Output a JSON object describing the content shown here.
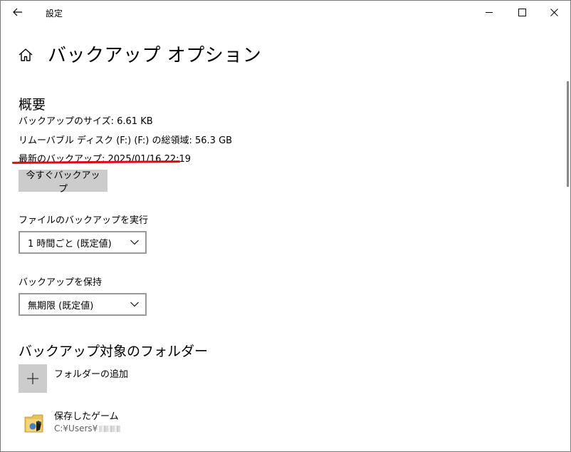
{
  "titlebar": {
    "back_icon": "back-arrow-icon",
    "app_title": "設定",
    "minimize_icon": "minimize-icon",
    "maximize_icon": "maximize-icon",
    "close_icon": "close-icon"
  },
  "header": {
    "home_icon": "home-icon",
    "title": "バックアップ オプション"
  },
  "overview": {
    "heading": "概要",
    "backup_size": "バックアップのサイズ: 6.61 KB",
    "disk_total": "リムーバブル ディスク (F:) (F:) の総領域: 56.3 GB",
    "latest_backup": "最新のバックアップ: 2025/01/16 22:19",
    "backup_now_label": "今すぐバックアップ",
    "highlight_color": "#e0061b"
  },
  "backup_frequency": {
    "label": "ファイルのバックアップを実行",
    "selected": "1 時間ごと (既定値)"
  },
  "keep_backups": {
    "label": "バックアップを保持",
    "selected": "無期限 (既定値)"
  },
  "folders": {
    "heading": "バックアップ対象のフォルダー",
    "add_label": "フォルダーの追加",
    "add_icon": "plus-icon",
    "items": [
      {
        "name": "保存したゲーム",
        "path": "C:¥Users¥",
        "icon": "saved-games-folder-icon"
      }
    ]
  },
  "colors": {
    "button_bg": "#cccccc",
    "select_border": "#999999",
    "path_text": "#5f5f5f"
  }
}
